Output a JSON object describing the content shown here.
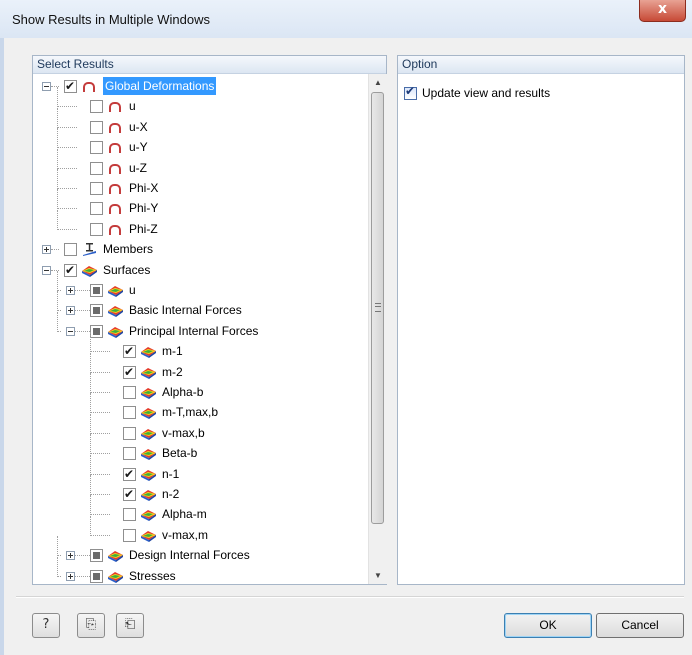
{
  "window": {
    "title": "Show Results in Multiple Windows",
    "close_glyph": "x"
  },
  "left_panel": {
    "header": "Select Results"
  },
  "right_panel": {
    "header": "Option",
    "option": {
      "label": "Update view and results",
      "checked": true
    }
  },
  "tree": [
    {
      "label": "Global Deformations",
      "level": 0,
      "expander": "minus",
      "check": "checked",
      "icon": "deformation-icon",
      "selected": true
    },
    {
      "label": "u",
      "level": 1,
      "expander": "none",
      "check": "unchecked",
      "icon": "deformation-icon"
    },
    {
      "label": "u-X",
      "level": 1,
      "expander": "none",
      "check": "unchecked",
      "icon": "deformation-icon"
    },
    {
      "label": "u-Y",
      "level": 1,
      "expander": "none",
      "check": "unchecked",
      "icon": "deformation-icon"
    },
    {
      "label": "u-Z",
      "level": 1,
      "expander": "none",
      "check": "unchecked",
      "icon": "deformation-icon"
    },
    {
      "label": "Phi-X",
      "level": 1,
      "expander": "none",
      "check": "unchecked",
      "icon": "deformation-icon"
    },
    {
      "label": "Phi-Y",
      "level": 1,
      "expander": "none",
      "check": "unchecked",
      "icon": "deformation-icon"
    },
    {
      "label": "Phi-Z",
      "level": 1,
      "expander": "none",
      "check": "unchecked",
      "icon": "deformation-icon"
    },
    {
      "label": "Members",
      "level": 0,
      "expander": "plus",
      "check": "unchecked",
      "icon": "member-icon"
    },
    {
      "label": "Surfaces",
      "level": 0,
      "expander": "minus",
      "check": "checked",
      "icon": "surface-icon"
    },
    {
      "label": "u",
      "level": 1,
      "expander": "plus",
      "check": "partial",
      "icon": "surface-icon"
    },
    {
      "label": "Basic Internal Forces",
      "level": 1,
      "expander": "plus",
      "check": "partial",
      "icon": "surface-icon"
    },
    {
      "label": "Principal Internal Forces",
      "level": 1,
      "expander": "minus",
      "check": "partial",
      "icon": "surface-icon"
    },
    {
      "label": "m-1",
      "level": 2,
      "expander": "none",
      "check": "checked",
      "icon": "surface-icon"
    },
    {
      "label": "m-2",
      "level": 2,
      "expander": "none",
      "check": "checked",
      "icon": "surface-icon"
    },
    {
      "label": "Alpha-b",
      "level": 2,
      "expander": "none",
      "check": "unchecked",
      "icon": "surface-icon"
    },
    {
      "label": "m-T,max,b",
      "level": 2,
      "expander": "none",
      "check": "unchecked",
      "icon": "surface-icon"
    },
    {
      "label": "v-max,b",
      "level": 2,
      "expander": "none",
      "check": "unchecked",
      "icon": "surface-icon"
    },
    {
      "label": "Beta-b",
      "level": 2,
      "expander": "none",
      "check": "unchecked",
      "icon": "surface-icon"
    },
    {
      "label": "n-1",
      "level": 2,
      "expander": "none",
      "check": "checked",
      "icon": "surface-icon"
    },
    {
      "label": "n-2",
      "level": 2,
      "expander": "none",
      "check": "checked",
      "icon": "surface-icon"
    },
    {
      "label": "Alpha-m",
      "level": 2,
      "expander": "none",
      "check": "unchecked",
      "icon": "surface-icon"
    },
    {
      "label": "v-max,m",
      "level": 2,
      "expander": "none",
      "check": "unchecked",
      "icon": "surface-icon"
    },
    {
      "label": "Design Internal Forces",
      "level": 1,
      "expander": "plus",
      "check": "partial",
      "icon": "surface-icon"
    },
    {
      "label": "Stresses",
      "level": 1,
      "expander": "plus",
      "check": "partial",
      "icon": "surface-icon"
    }
  ],
  "footer": {
    "icon_buttons": [
      {
        "name": "help-button",
        "icon": "help-icon",
        "glyph": "?"
      },
      {
        "name": "copy-button",
        "icon": "copy-icon",
        "glyph": "⎘"
      },
      {
        "name": "paste-button",
        "icon": "paste-icon",
        "glyph": "⎗"
      }
    ],
    "ok_label": "OK",
    "cancel_label": "Cancel"
  },
  "colors": {
    "selection": "#3399ff",
    "deformation_icon": "#c43c3c"
  }
}
